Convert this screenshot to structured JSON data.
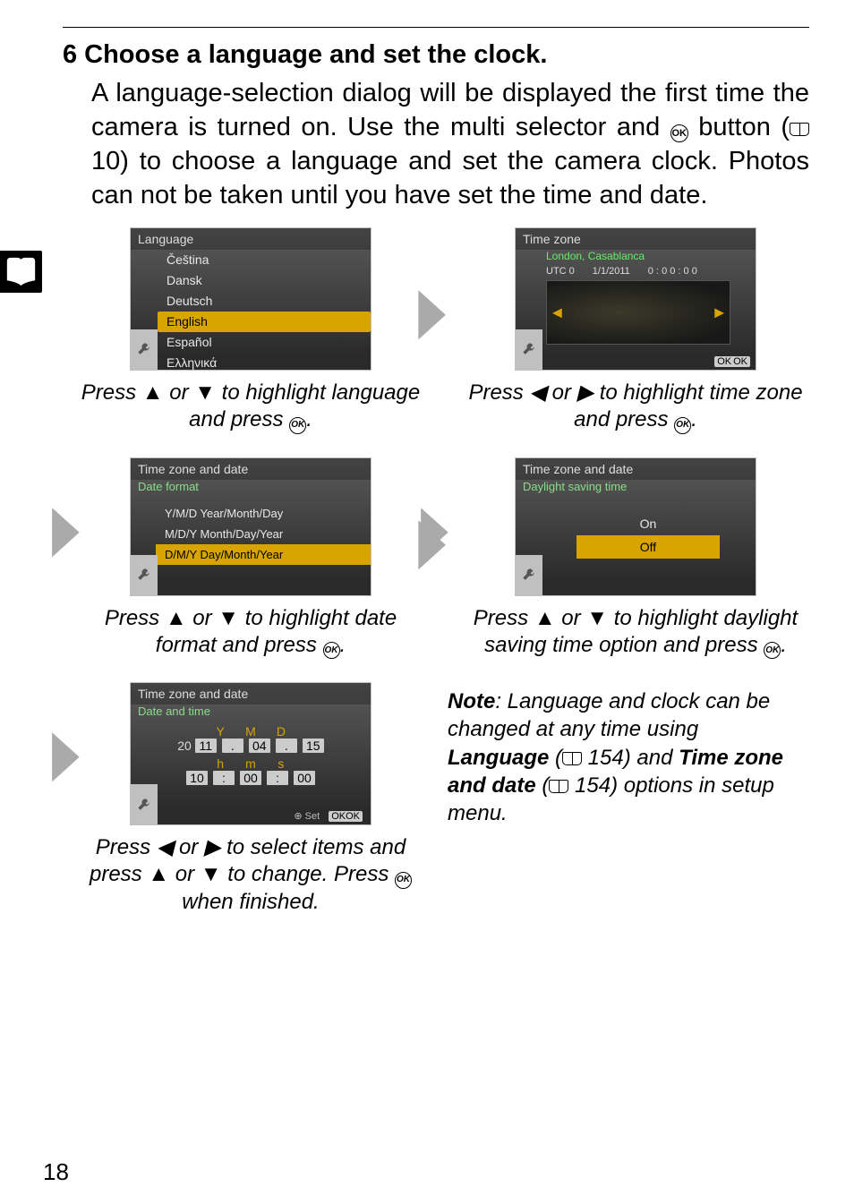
{
  "step_num": "6",
  "heading": "Choose a language and set the clock.",
  "body_a": "A language-selection dialog will be displayed the first time the camera is turned on. Use the multi selector and ",
  "body_b": " button (",
  "body_c": " 10) to choose a language and set the camera clock. Photos can not be taken until you have set the time and date.",
  "lang_screen": {
    "title": "Language",
    "items": [
      "Čeština",
      "Dansk",
      "Deutsch",
      "English",
      "Español",
      "Ελληνικά"
    ],
    "selected_index": 3
  },
  "caption_lang_a": "Press ",
  "caption_lang_b": " or ",
  "caption_lang_c": " to highlight language and press ",
  "caption_lang_d": ".",
  "tz_screen": {
    "title": "Time zone",
    "city": "London, Casablanca",
    "utc": "UTC 0",
    "date": "1/1/2011",
    "time": "0 : 0 0 : 0 0",
    "footer": "OK"
  },
  "caption_tz_a": "Press ",
  "caption_tz_b": " or ",
  "caption_tz_c": " to highlight time zone and press ",
  "caption_tz_d": ".",
  "date_fmt_screen": {
    "title": "Time zone and date",
    "subtitle": "Date format",
    "items": [
      "Y/M/D Year/Month/Day",
      "M/D/Y Month/Day/Year",
      "D/M/Y Day/Month/Year"
    ],
    "selected_index": 2
  },
  "caption_date_a": "Press ",
  "caption_date_b": " or ",
  "caption_date_c": " to highlight date format and press ",
  "caption_date_d": ".",
  "dst_screen": {
    "title": "Time zone and date",
    "subtitle": "Daylight saving time",
    "items": [
      "On",
      "Off"
    ],
    "selected_index": 1
  },
  "caption_dst_a": "Press ",
  "caption_dst_b": " or ",
  "caption_dst_c": " to highlight daylight saving time option and press ",
  "caption_dst_d": ".",
  "dt_screen": {
    "title": "Time zone and date",
    "subtitle": "Date and time",
    "y": "Y",
    "m": "M",
    "d": "D",
    "year_prefix": "20",
    "year": "11",
    "month": "04",
    "day": "15",
    "h": "h",
    "mm": "m",
    "s": "s",
    "hour": "10",
    "min": "00",
    "sec": "00",
    "set_label": "Set",
    "footer": "OK"
  },
  "caption_dt_a": "Press ",
  "caption_dt_b": " or ",
  "caption_dt_c": " to select items and press ",
  "caption_dt_d": " or ",
  "caption_dt_e": " to change. Press ",
  "caption_dt_f": " when finished.",
  "note": {
    "prefix": "Note",
    "a": ": Language and clock can be changed at any time using ",
    "opt1": "Language",
    "b": " (",
    "p1": " 154) and ",
    "opt2": "Time zone and date",
    "c": " (",
    "p2": " 154) options in setup menu."
  },
  "ok_glyph": "OK",
  "page_number": "18"
}
